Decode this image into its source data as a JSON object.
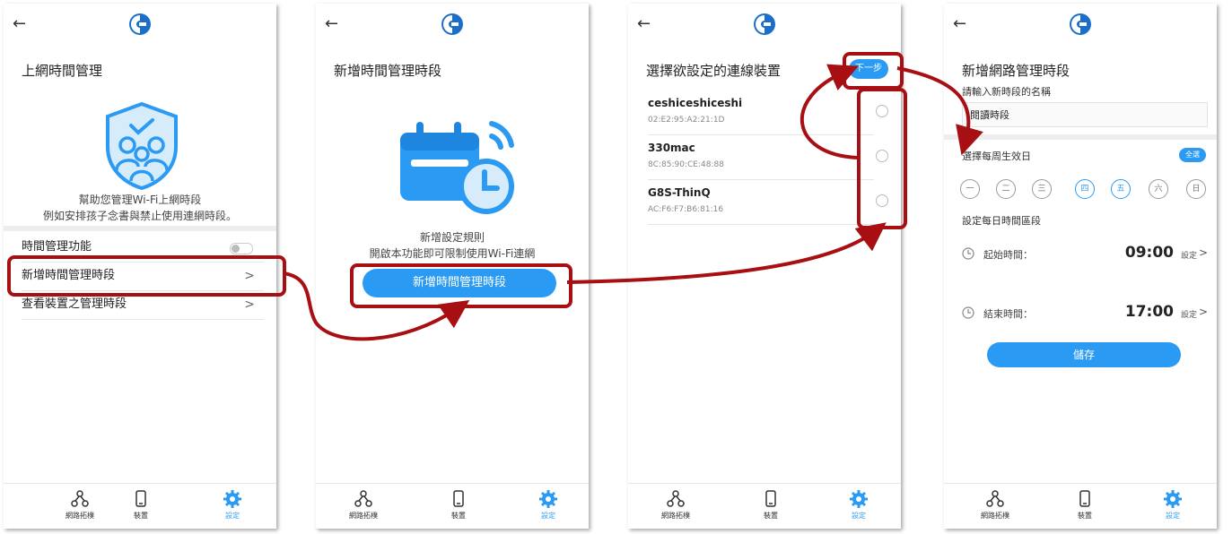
{
  "screen1": {
    "title": "上網時間管理",
    "desc_line1": "幫助您管理Wi-Fi上網時段",
    "desc_line2": "例如安排孩子念書與禁止使用連網時段。",
    "rows": {
      "feature": "時間管理功能",
      "add_period": "新增時間管理時段",
      "view_device": "查看裝置之管理時段"
    }
  },
  "screen2": {
    "title": "新增時間管理時段",
    "rule_title": "新增設定規則",
    "rule_desc": "開啟本功能即可限制使用Wi-Fi連網",
    "add_button": "新增時間管理時段"
  },
  "screen3": {
    "title": "選擇欲設定的連線裝置",
    "next_button": "下一步",
    "devices": [
      {
        "name": "ceshiceshiceshi",
        "mac": "02:E2:95:A2:21:1D"
      },
      {
        "name": "330mac",
        "mac": "8C:85:90:CE:48:88"
      },
      {
        "name": "G8S-ThinQ",
        "mac": "AC:F6:F7:B6:81:16"
      }
    ]
  },
  "screen4": {
    "title": "新增網路管理時段",
    "name_prompt": "請輸入新時段的名稱",
    "name_value": "閱讀時段",
    "weekday_label": "選擇每周生效日",
    "select_all": "全選",
    "days": [
      "一",
      "二",
      "三",
      "四",
      "五",
      "六",
      "日"
    ],
    "days_selected": [
      "四",
      "五"
    ],
    "time_section": "設定每日時間區段",
    "start_label": "起始時間：",
    "start_time": "09:00",
    "end_label": "結束時間：",
    "end_time": "17:00",
    "set_label": "設定",
    "save_button": "儲存"
  },
  "nav": {
    "topology": "網路拓樸",
    "devices": "裝置",
    "settings": "設定"
  },
  "colors": {
    "accent": "#2b9af3",
    "highlight": "#a80f12",
    "logo": "#1c6fc9"
  }
}
